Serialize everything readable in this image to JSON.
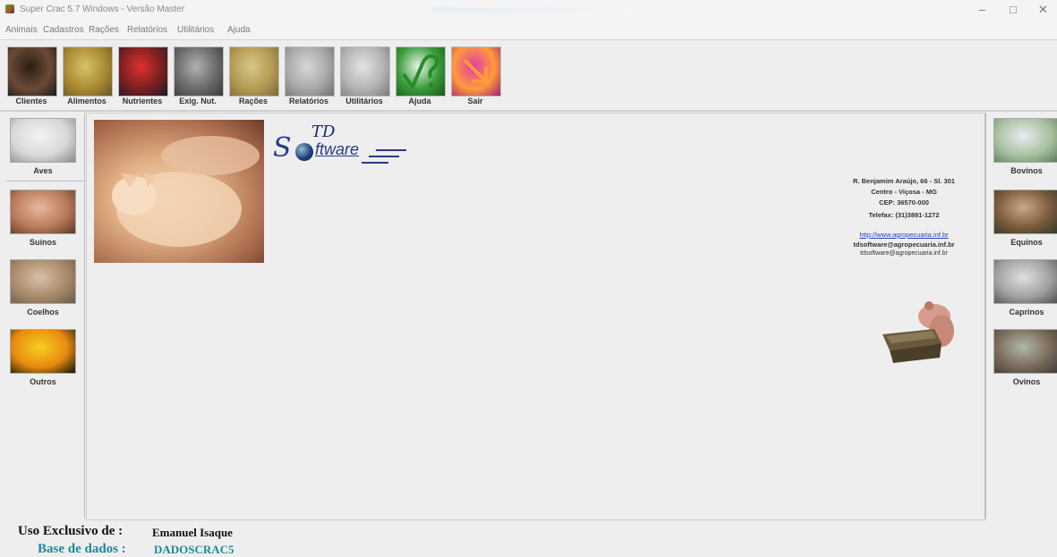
{
  "window": {
    "title": "Super Crac 5.7 Windows - Versão Master",
    "minimize_glyph": "–",
    "maximize_glyph": "□",
    "close_glyph": "✕"
  },
  "menu": [
    "Animais",
    "Cadastros",
    "Rações",
    "Relatórios",
    "Utilitários",
    "Ajuda"
  ],
  "toolbar": [
    {
      "label": "Clientes",
      "icon": "businessman-photo-icon",
      "colors": [
        "#2b1e14",
        "#6b4a36",
        "#1a1a1a"
      ]
    },
    {
      "label": "Alimentos",
      "icon": "grain-photo-icon",
      "colors": [
        "#d8c26a",
        "#a98a32",
        "#6b5520"
      ]
    },
    {
      "label": "Nutrientes",
      "icon": "flask-photo-icon",
      "colors": [
        "#e03030",
        "#7a2020",
        "#1a1a2a"
      ]
    },
    {
      "label": "Exig. Nut.",
      "icon": "animal-photo-icon",
      "colors": [
        "#b0b0b0",
        "#6a6a6a",
        "#3a3a3a"
      ]
    },
    {
      "label": "Rações",
      "icon": "feed-bag-photo-icon",
      "colors": [
        "#d8c68a",
        "#b49a52",
        "#7a6a3a"
      ]
    },
    {
      "label": "Relatórios",
      "icon": "printer-icon",
      "colors": [
        "#d8d8d8",
        "#a8a8a8",
        "#707070"
      ]
    },
    {
      "label": "Utilitários",
      "icon": "mouse-icon",
      "colors": [
        "#e4e4e4",
        "#b4b4b4",
        "#7a7a7a"
      ]
    },
    {
      "label": "Ajuda",
      "icon": "question-mark-icon",
      "colors": [
        "#e8f4e8",
        "#3a9a3a",
        "#1a5a1a"
      ]
    },
    {
      "label": "Sair",
      "icon": "exit-arrow-icon",
      "colors": [
        "#e03aa8",
        "#ff9a3a",
        "#a0207a"
      ]
    }
  ],
  "left_animals": [
    {
      "label": "Aves",
      "icon": "chicken-photo-icon",
      "colors": [
        "#f4f4f4",
        "#d8d8d8",
        "#8a8a8a"
      ]
    },
    {
      "label": "Suínos",
      "icon": "pigs-photo-icon",
      "colors": [
        "#e8b8a0",
        "#b87a5a",
        "#5a3a2a"
      ]
    },
    {
      "label": "Coelhos",
      "icon": "rabbit-photo-icon",
      "colors": [
        "#d8c0a8",
        "#a88a6a",
        "#6a5a4a"
      ]
    },
    {
      "label": "Outros",
      "icon": "toucan-photo-icon",
      "colors": [
        "#f4d020",
        "#e88a10",
        "#101010"
      ]
    }
  ],
  "right_animals": [
    {
      "label": "Bovinos",
      "icon": "cattle-photo-icon",
      "colors": [
        "#e8ecf0",
        "#a8c0a0",
        "#5a7a5a"
      ]
    },
    {
      "label": "Equinos",
      "icon": "horse-photo-icon",
      "colors": [
        "#c8a888",
        "#7a5a3a",
        "#2a3a2a"
      ]
    },
    {
      "label": "Caprinos",
      "icon": "goat-photo-icon",
      "colors": [
        "#e0e0e0",
        "#a0a0a0",
        "#4a4a4a"
      ]
    },
    {
      "label": "Ovinos",
      "icon": "sheep-photo-icon",
      "colors": [
        "#b0b8a8",
        "#7a6a5a",
        "#3a3a3a"
      ]
    }
  ],
  "logo": {
    "top": "TD",
    "s": "S",
    "rest": "ftware"
  },
  "address": [
    "R. Benjamim Araújo, 66 - Sl. 301",
    "Centro - Viçosa - MG",
    "CEP: 36570-000",
    "Telefax: (31)3891-1272"
  ],
  "contacts": {
    "website": "http://www.agropecuaria.inf.br",
    "email1": "tdsoftware@agropecuaria.inf.br",
    "email2": "tdsoftware@agropecuaria.inf.br"
  },
  "footer": {
    "user_label": "Uso Exclusivo de :",
    "user_value": "Emanuel Isaque",
    "db_label": "Base de dados :",
    "db_value": "DADOSCRAC5"
  }
}
